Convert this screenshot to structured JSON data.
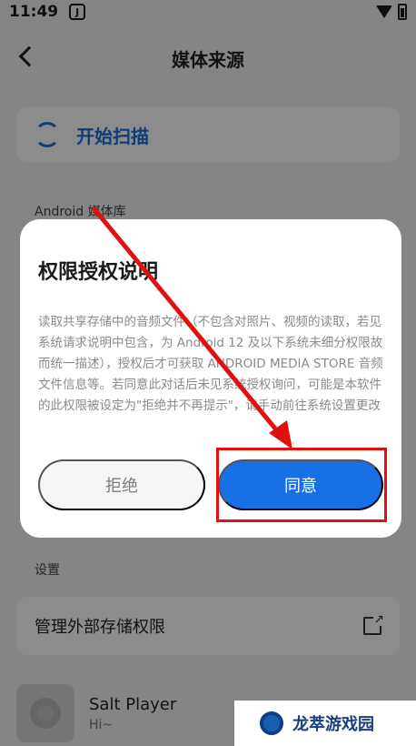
{
  "status": {
    "time": "11:49",
    "app_badge": "J"
  },
  "header": {
    "title": "媒体来源"
  },
  "scan": {
    "label": "开始扫描"
  },
  "library": {
    "section_label": "Android 媒体库"
  },
  "settings": {
    "section_label": "设置",
    "manage_label": "管理外部存储权限"
  },
  "player": {
    "name": "Salt Player",
    "subtitle": "Hi~"
  },
  "dialog": {
    "title": "权限授权说明",
    "body": "读取共享存储中的音频文件（不包含对照片、视频的读取，若见系统请求说明中包含，为 Android 12 及以下系统未细分权限故而统一描述），授权后才可获取 ANDROID MEDIA STORE 音频文件信息等。若同意此对话后未见系统授权询问，可能是本软件的此权限被设定为\"拒绝并不再提示\"，请手动前往系统设置更改",
    "deny_label": "拒绝",
    "agree_label": "同意"
  },
  "colors": {
    "accent": "#1770e6",
    "annotation": "#e01010"
  },
  "watermark": {
    "text": "龙萃游戏园"
  }
}
